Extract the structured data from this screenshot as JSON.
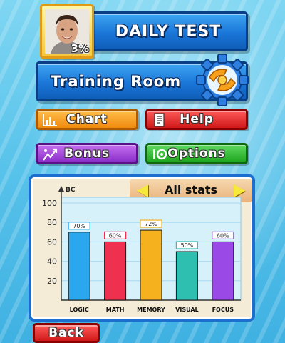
{
  "menu": {
    "daily_test_label": "DAILY TEST",
    "progress_percent": "3%",
    "training_room_label": "Training Room",
    "chart_label": "Chart",
    "help_label": "Help",
    "bonus_label": "Bonus",
    "options_label": "Options",
    "back_label": "Back"
  },
  "stats": {
    "title": "All stats",
    "unit_label": "BC"
  },
  "chart_data": {
    "type": "bar",
    "categories": [
      "LOGIC",
      "MATH",
      "MEMORY",
      "VISUAL",
      "FOCUS"
    ],
    "values": [
      70,
      60,
      72,
      50,
      60
    ],
    "value_labels": [
      "70%",
      "60%",
      "72%",
      "50%",
      "60%"
    ],
    "ylabel": "BC",
    "yticks": [
      20,
      40,
      60,
      80,
      100
    ],
    "ylim": [
      0,
      100
    ],
    "colors": [
      "#2aa7ef",
      "#f0304f",
      "#f6b21e",
      "#2fbfb0",
      "#9a48e6"
    ],
    "label_colors": [
      "#2aa7ef",
      "#f0304f",
      "#f6b21e",
      "#2fbfb0",
      "#9a48e6"
    ]
  }
}
